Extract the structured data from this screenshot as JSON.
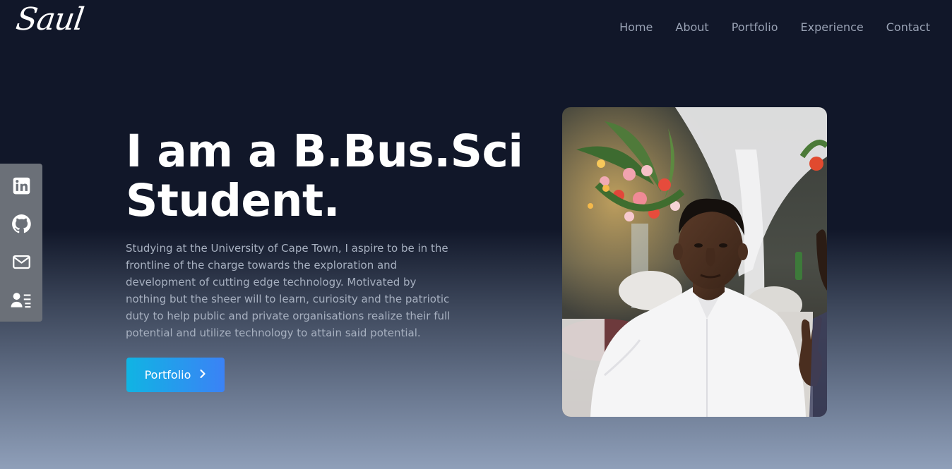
{
  "logo": {
    "text": "Saul"
  },
  "nav": {
    "items": [
      {
        "label": "Home"
      },
      {
        "label": "About"
      },
      {
        "label": "Portfolio"
      },
      {
        "label": "Experience"
      },
      {
        "label": "Contact"
      }
    ]
  },
  "social": {
    "icons": [
      "linkedin-icon",
      "github-icon",
      "mail-icon",
      "contact-card-icon"
    ],
    "color": "#ffffff",
    "background": "#6b7078"
  },
  "hero": {
    "title": "I am a B.Bus.Sci Student.",
    "description": "Studying at the University of Cape Town, I aspire to be in the frontline of the charge towards the exploration and development of cutting edge technology. Motivated by nothing but the sheer will to learn, curiosity and the patriotic duty to help public and private organisations realize their full potential and utilize technology to attain said potential.",
    "cta_label": "Portfolio",
    "cta_icon": "chevron-right-icon"
  },
  "colors": {
    "background_top": "#111729",
    "background_bottom": "#8f9fb9",
    "accent_start": "#10b4e3",
    "accent_end": "#3b82f6",
    "nav_text": "#9aa3b5"
  }
}
